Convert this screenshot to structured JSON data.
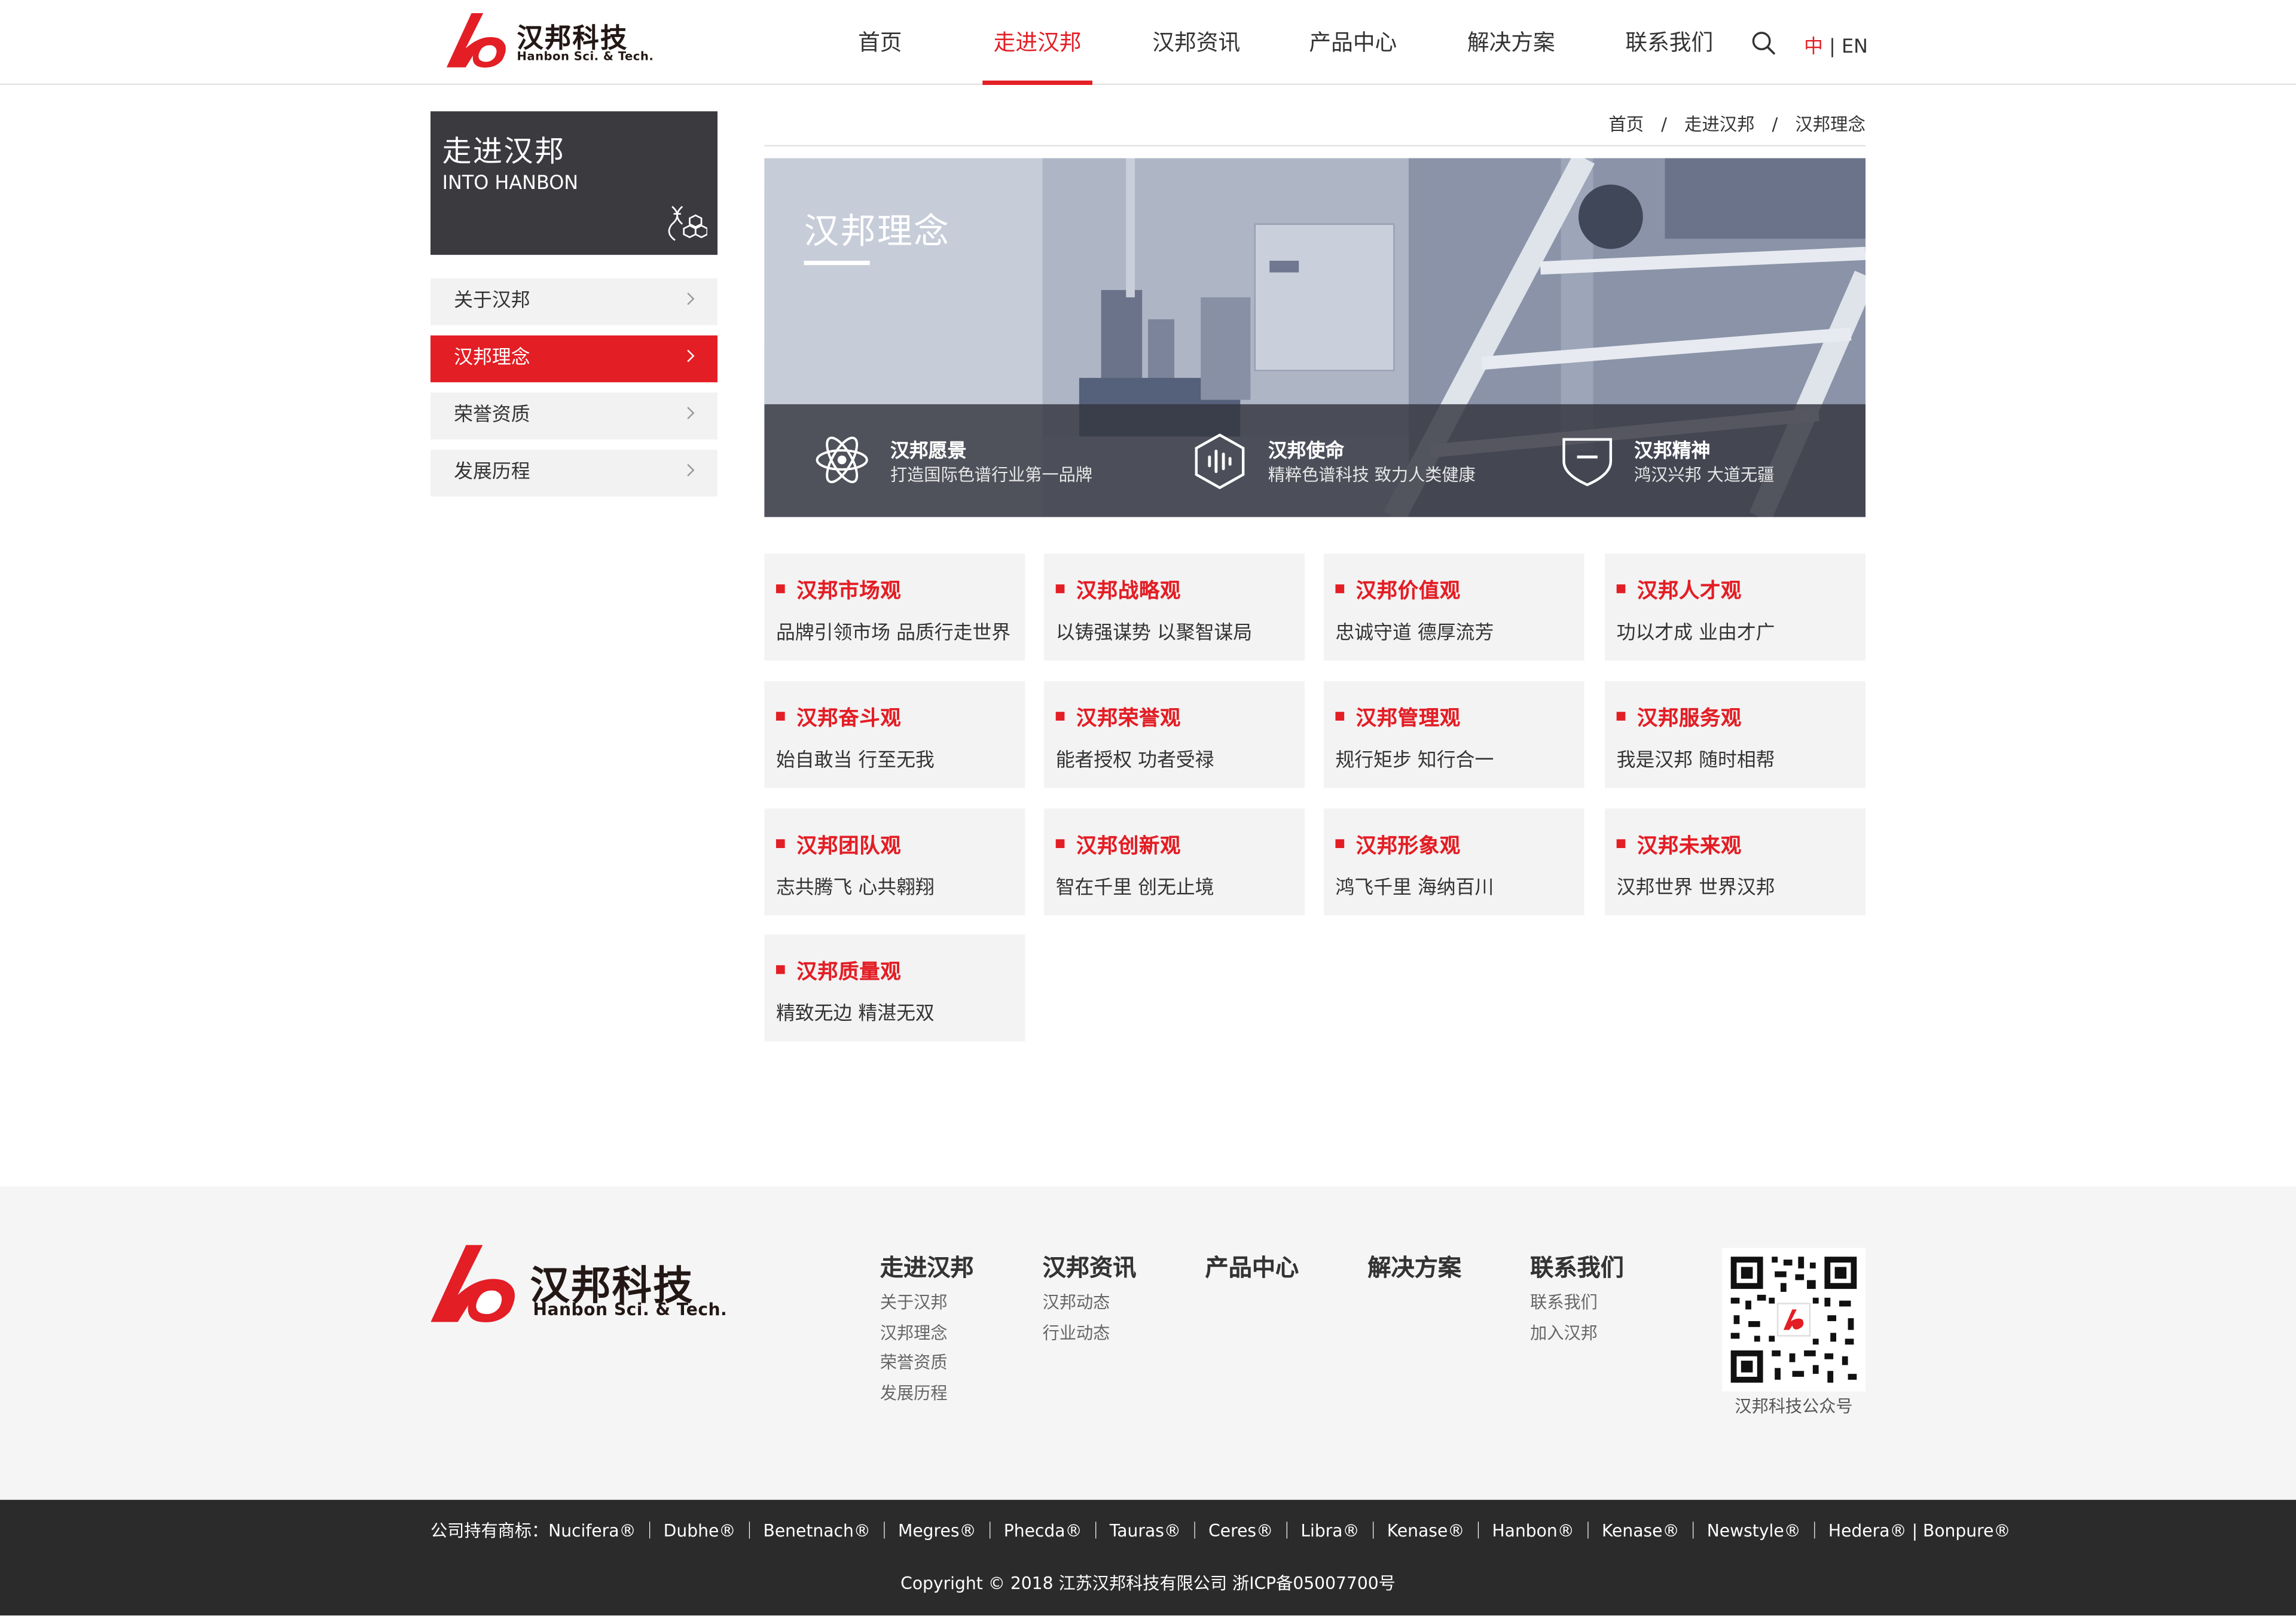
{
  "header": {
    "brand_cn": "汉邦科技",
    "brand_en": "Hanbon Sci. & Tech.",
    "nav": [
      {
        "label": "首页",
        "active": false
      },
      {
        "label": "走进汉邦",
        "active": true
      },
      {
        "label": "汉邦资讯",
        "active": false
      },
      {
        "label": "产品中心",
        "active": false
      },
      {
        "label": "解决方案",
        "active": false
      },
      {
        "label": "联系我们",
        "active": false
      }
    ],
    "search_icon": "search-icon",
    "lang_active": "中",
    "lang_sep": "|",
    "lang_other": "EN"
  },
  "sidebar": {
    "title": "走进汉邦",
    "subtitle": "INTO HANBON",
    "icon": "molecule-icon",
    "items": [
      {
        "label": "关于汉邦",
        "active": false
      },
      {
        "label": "汉邦理念",
        "active": true
      },
      {
        "label": "荣誉资质",
        "active": false
      },
      {
        "label": "发展历程",
        "active": false
      }
    ]
  },
  "breadcrumb": {
    "items": [
      "首页",
      "走进汉邦",
      "汉邦理念"
    ],
    "separator": "/"
  },
  "banner": {
    "title": "汉邦理念",
    "pillars": [
      {
        "icon": "atom-icon",
        "title": "汉邦愿景",
        "text": "打造国际色谱行业第一品牌"
      },
      {
        "icon": "hexagon-wave-icon",
        "title": "汉邦使命",
        "text": "精粹色谱科技 致力人类健康"
      },
      {
        "icon": "shield-icon",
        "title": "汉邦精神",
        "text": "鸿汉兴邦 大道无疆"
      }
    ]
  },
  "values": [
    {
      "title": "汉邦市场观",
      "text": "品牌引领市场 品质行走世界"
    },
    {
      "title": "汉邦战略观",
      "text": "以铸强谋势 以聚智谋局"
    },
    {
      "title": "汉邦价值观",
      "text": "忠诚守道 德厚流芳"
    },
    {
      "title": "汉邦人才观",
      "text": "功以才成 业由才广"
    },
    {
      "title": "汉邦奋斗观",
      "text": "始自敢当 行至无我"
    },
    {
      "title": "汉邦荣誉观",
      "text": "能者授权 功者受禄"
    },
    {
      "title": "汉邦管理观",
      "text": "规行矩步 知行合一"
    },
    {
      "title": "汉邦服务观",
      "text": "我是汉邦 随时相帮"
    },
    {
      "title": "汉邦团队观",
      "text": "志共腾飞 心共翱翔"
    },
    {
      "title": "汉邦创新观",
      "text": "智在千里 创无止境"
    },
    {
      "title": "汉邦形象观",
      "text": "鸿飞千里 海纳百川"
    },
    {
      "title": "汉邦未来观",
      "text": "汉邦世界 世界汉邦"
    },
    {
      "title": "汉邦质量观",
      "text": "精致无边 精湛无双"
    }
  ],
  "footer": {
    "brand_cn": "汉邦科技",
    "brand_en": "Hanbon Sci. & Tech.",
    "columns": [
      {
        "title": "走进汉邦",
        "links": [
          "关于汉邦",
          "汉邦理念",
          "荣誉资质",
          "发展历程"
        ]
      },
      {
        "title": "汉邦资讯",
        "links": [
          "汉邦动态",
          "行业动态"
        ]
      },
      {
        "title": "产品中心",
        "links": []
      },
      {
        "title": "解决方案",
        "links": []
      },
      {
        "title": "联系我们",
        "links": [
          "联系我们",
          "加入汉邦"
        ]
      }
    ],
    "qr_caption": "汉邦科技公众号",
    "trademarks": "公司持有商标：Nucifera® ｜ Dubhe® ｜ Benetnach® ｜ Megres® ｜ Phecda® ｜ Tauras® ｜ Ceres® ｜ Libra® ｜ Kenase® ｜ Hanbon® ｜ Kenase® ｜ Newstyle® ｜ Hedera® | Bonpure®",
    "copyright": "Copyright © 2018 江苏汉邦科技有限公司 浙ICP备05007700号"
  },
  "colors": {
    "accent": "#e31e25",
    "dark": "#3b3a3f",
    "footer_bg": "#f5f5f6",
    "bottom_bg": "#2b2b2b"
  }
}
